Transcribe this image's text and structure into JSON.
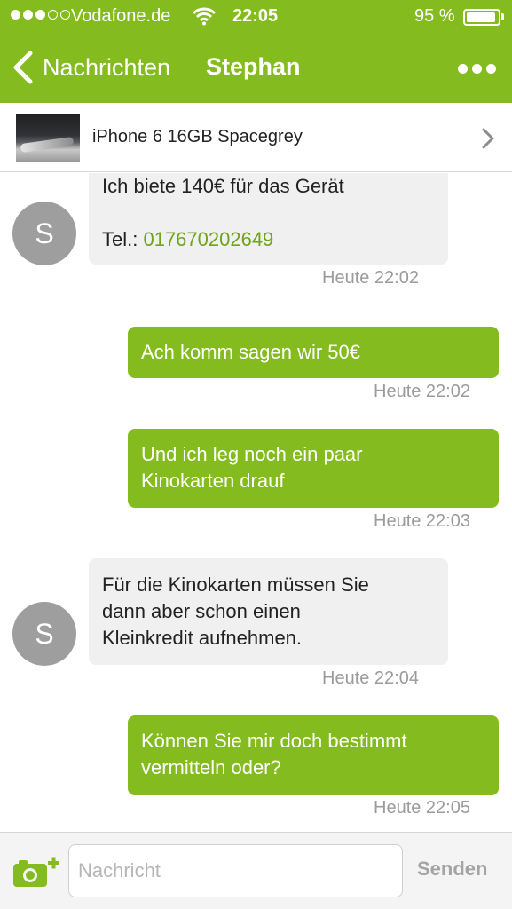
{
  "status_bar": {
    "carrier": "Vodafone.de",
    "time": "22:05",
    "battery_percent": "95 %",
    "battery_level": 0.95,
    "signal_bars_filled": 3,
    "signal_bars_total": 5
  },
  "nav": {
    "back_label": "Nachrichten",
    "title": "Stephan"
  },
  "listing": {
    "title": "iPhone 6 16GB Spacegrey"
  },
  "messages": [
    {
      "side": "incoming",
      "avatar": "S",
      "line1": "Ich biete 140€ für das Gerät",
      "tel_label": "Tel.: ",
      "phone": "017670202649",
      "time": "Heute 22:02"
    },
    {
      "side": "outgoing",
      "line1": "Ach komm sagen wir 50€",
      "time": "Heute 22:02"
    },
    {
      "side": "outgoing",
      "line1": "Und ich leg noch ein paar",
      "line2": "Kinokarten drauf",
      "time": "Heute 22:03"
    },
    {
      "side": "incoming",
      "avatar": "S",
      "line1": "Für die Kinokarten müssen Sie",
      "line2": "dann aber schon einen",
      "line3": "Kleinkredit aufnehmen.",
      "time": "Heute 22:04"
    },
    {
      "side": "outgoing",
      "line1": "Können Sie mir doch bestimmt",
      "line2": "vermitteln oder?",
      "time": "Heute 22:05"
    }
  ],
  "input_bar": {
    "placeholder": "Nachricht",
    "value": "",
    "send_label": "Senden"
  },
  "colors": {
    "brand_green": "#84bc1f",
    "phone_link": "#6fa31c",
    "incoming_bubble": "#f0f0f0",
    "timestamp": "#9b9b9b"
  },
  "icons": [
    "wifi-icon",
    "battery-icon",
    "back-chevron-icon",
    "more-dots-icon",
    "chevron-right-icon",
    "camera-add-icon"
  ]
}
